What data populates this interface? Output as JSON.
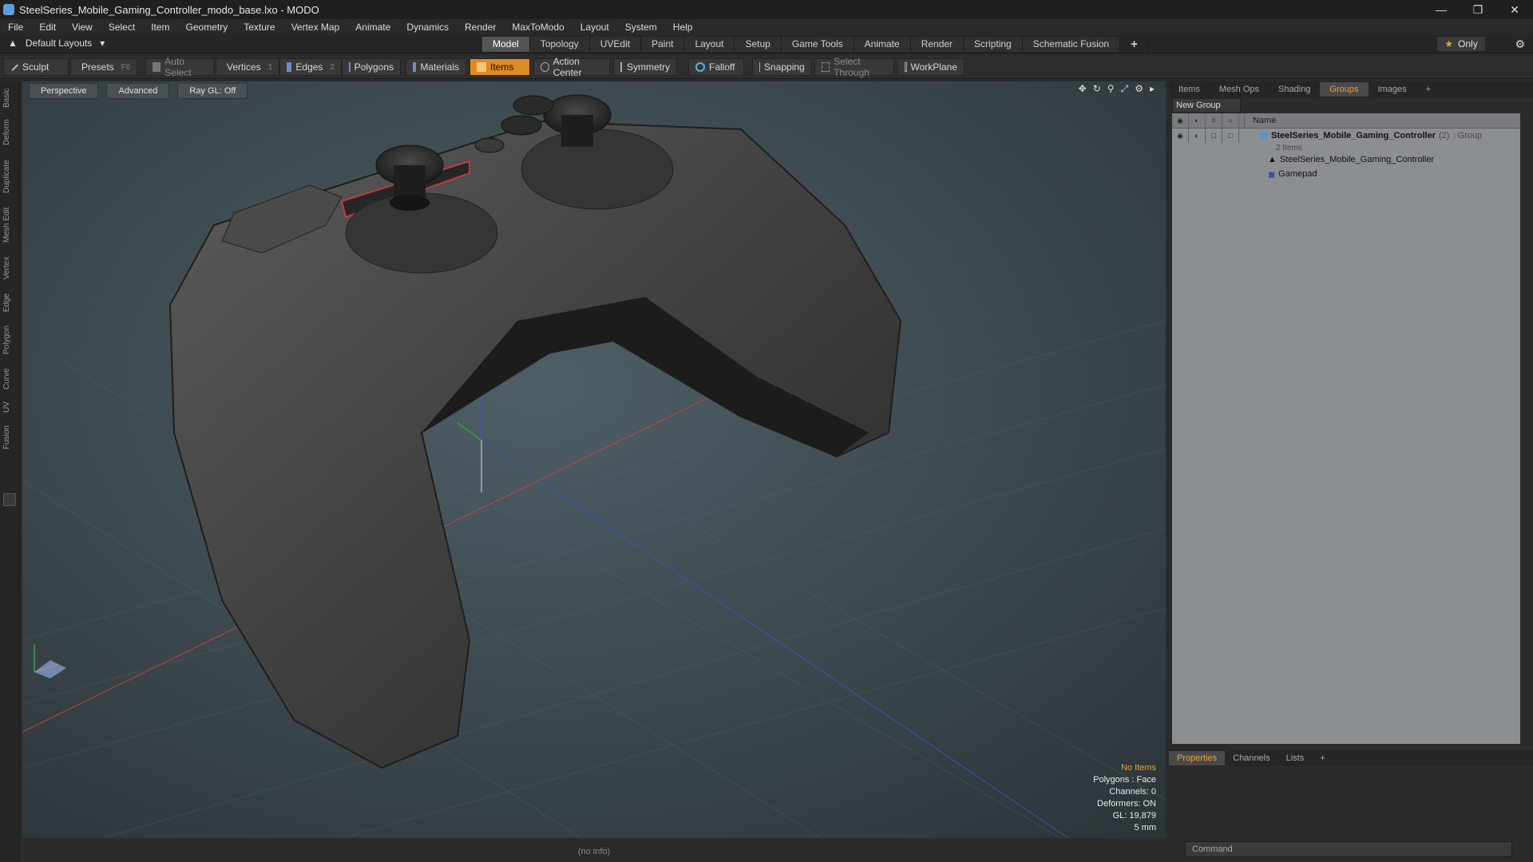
{
  "window": {
    "title": "SteelSeries_Mobile_Gaming_Controller_modo_base.lxo - MODO"
  },
  "menu": [
    "File",
    "Edit",
    "View",
    "Select",
    "Item",
    "Geometry",
    "Texture",
    "Vertex Map",
    "Animate",
    "Dynamics",
    "Render",
    "MaxToModo",
    "Layout",
    "System",
    "Help"
  ],
  "layoutbar": {
    "default_layouts": "Default Layouts",
    "tabs": [
      "Model",
      "Topology",
      "UVEdit",
      "Paint",
      "Layout",
      "Setup",
      "Game Tools",
      "Animate",
      "Render",
      "Scripting",
      "Schematic Fusion"
    ],
    "active_tab": "Model",
    "only_label": "Only"
  },
  "toolbar": {
    "sculpt": "Sculpt",
    "presets": "Presets",
    "presets_key": "F6",
    "auto_select": "Auto Select",
    "vertices": "Vertices",
    "vertices_key": "1",
    "edges": "Edges",
    "edges_key": "2",
    "polygons": "Polygons",
    "materials": "Materials",
    "items": "Items",
    "action_center": "Action Center",
    "symmetry": "Symmetry",
    "falloff": "Falloff",
    "snapping": "Snapping",
    "select_through": "Select Through",
    "workplane": "WorkPlane"
  },
  "left_tabs": [
    "Basic",
    "Deform",
    "Duplicate",
    "Mesh Edit",
    "Vertex",
    "Edge",
    "Polygon",
    "Curve",
    "UV",
    "Fusion"
  ],
  "viewport": {
    "view_mode": "Perspective",
    "shading": "Advanced",
    "raygl": "Ray GL: Off",
    "info": {
      "no_items": "No Items",
      "polygons": "Polygons : Face",
      "channels": "Channels: 0",
      "deformers": "Deformers: ON",
      "gl": "GL: 19,879",
      "scale": "5 mm"
    }
  },
  "status": {
    "text": "(no info)"
  },
  "right_panel": {
    "tabs": [
      "Items",
      "Mesh Ops",
      "Shading",
      "Groups",
      "Images"
    ],
    "active_tab": "Groups",
    "new_group": "New Group",
    "name_header": "Name",
    "group_name": "SteelSeries_Mobile_Gaming_Controller",
    "group_count": "(2)",
    "group_type": ": Group",
    "items_count": "2 Items",
    "child1": "SteelSeries_Mobile_Gaming_Controller",
    "child2": "Gamepad"
  },
  "properties": {
    "tabs": [
      "Properties",
      "Channels",
      "Lists"
    ],
    "active_tab": "Properties",
    "command_placeholder": "Command"
  },
  "colors": {
    "accent": "#e08a22",
    "selection_text": "#f0a130"
  }
}
